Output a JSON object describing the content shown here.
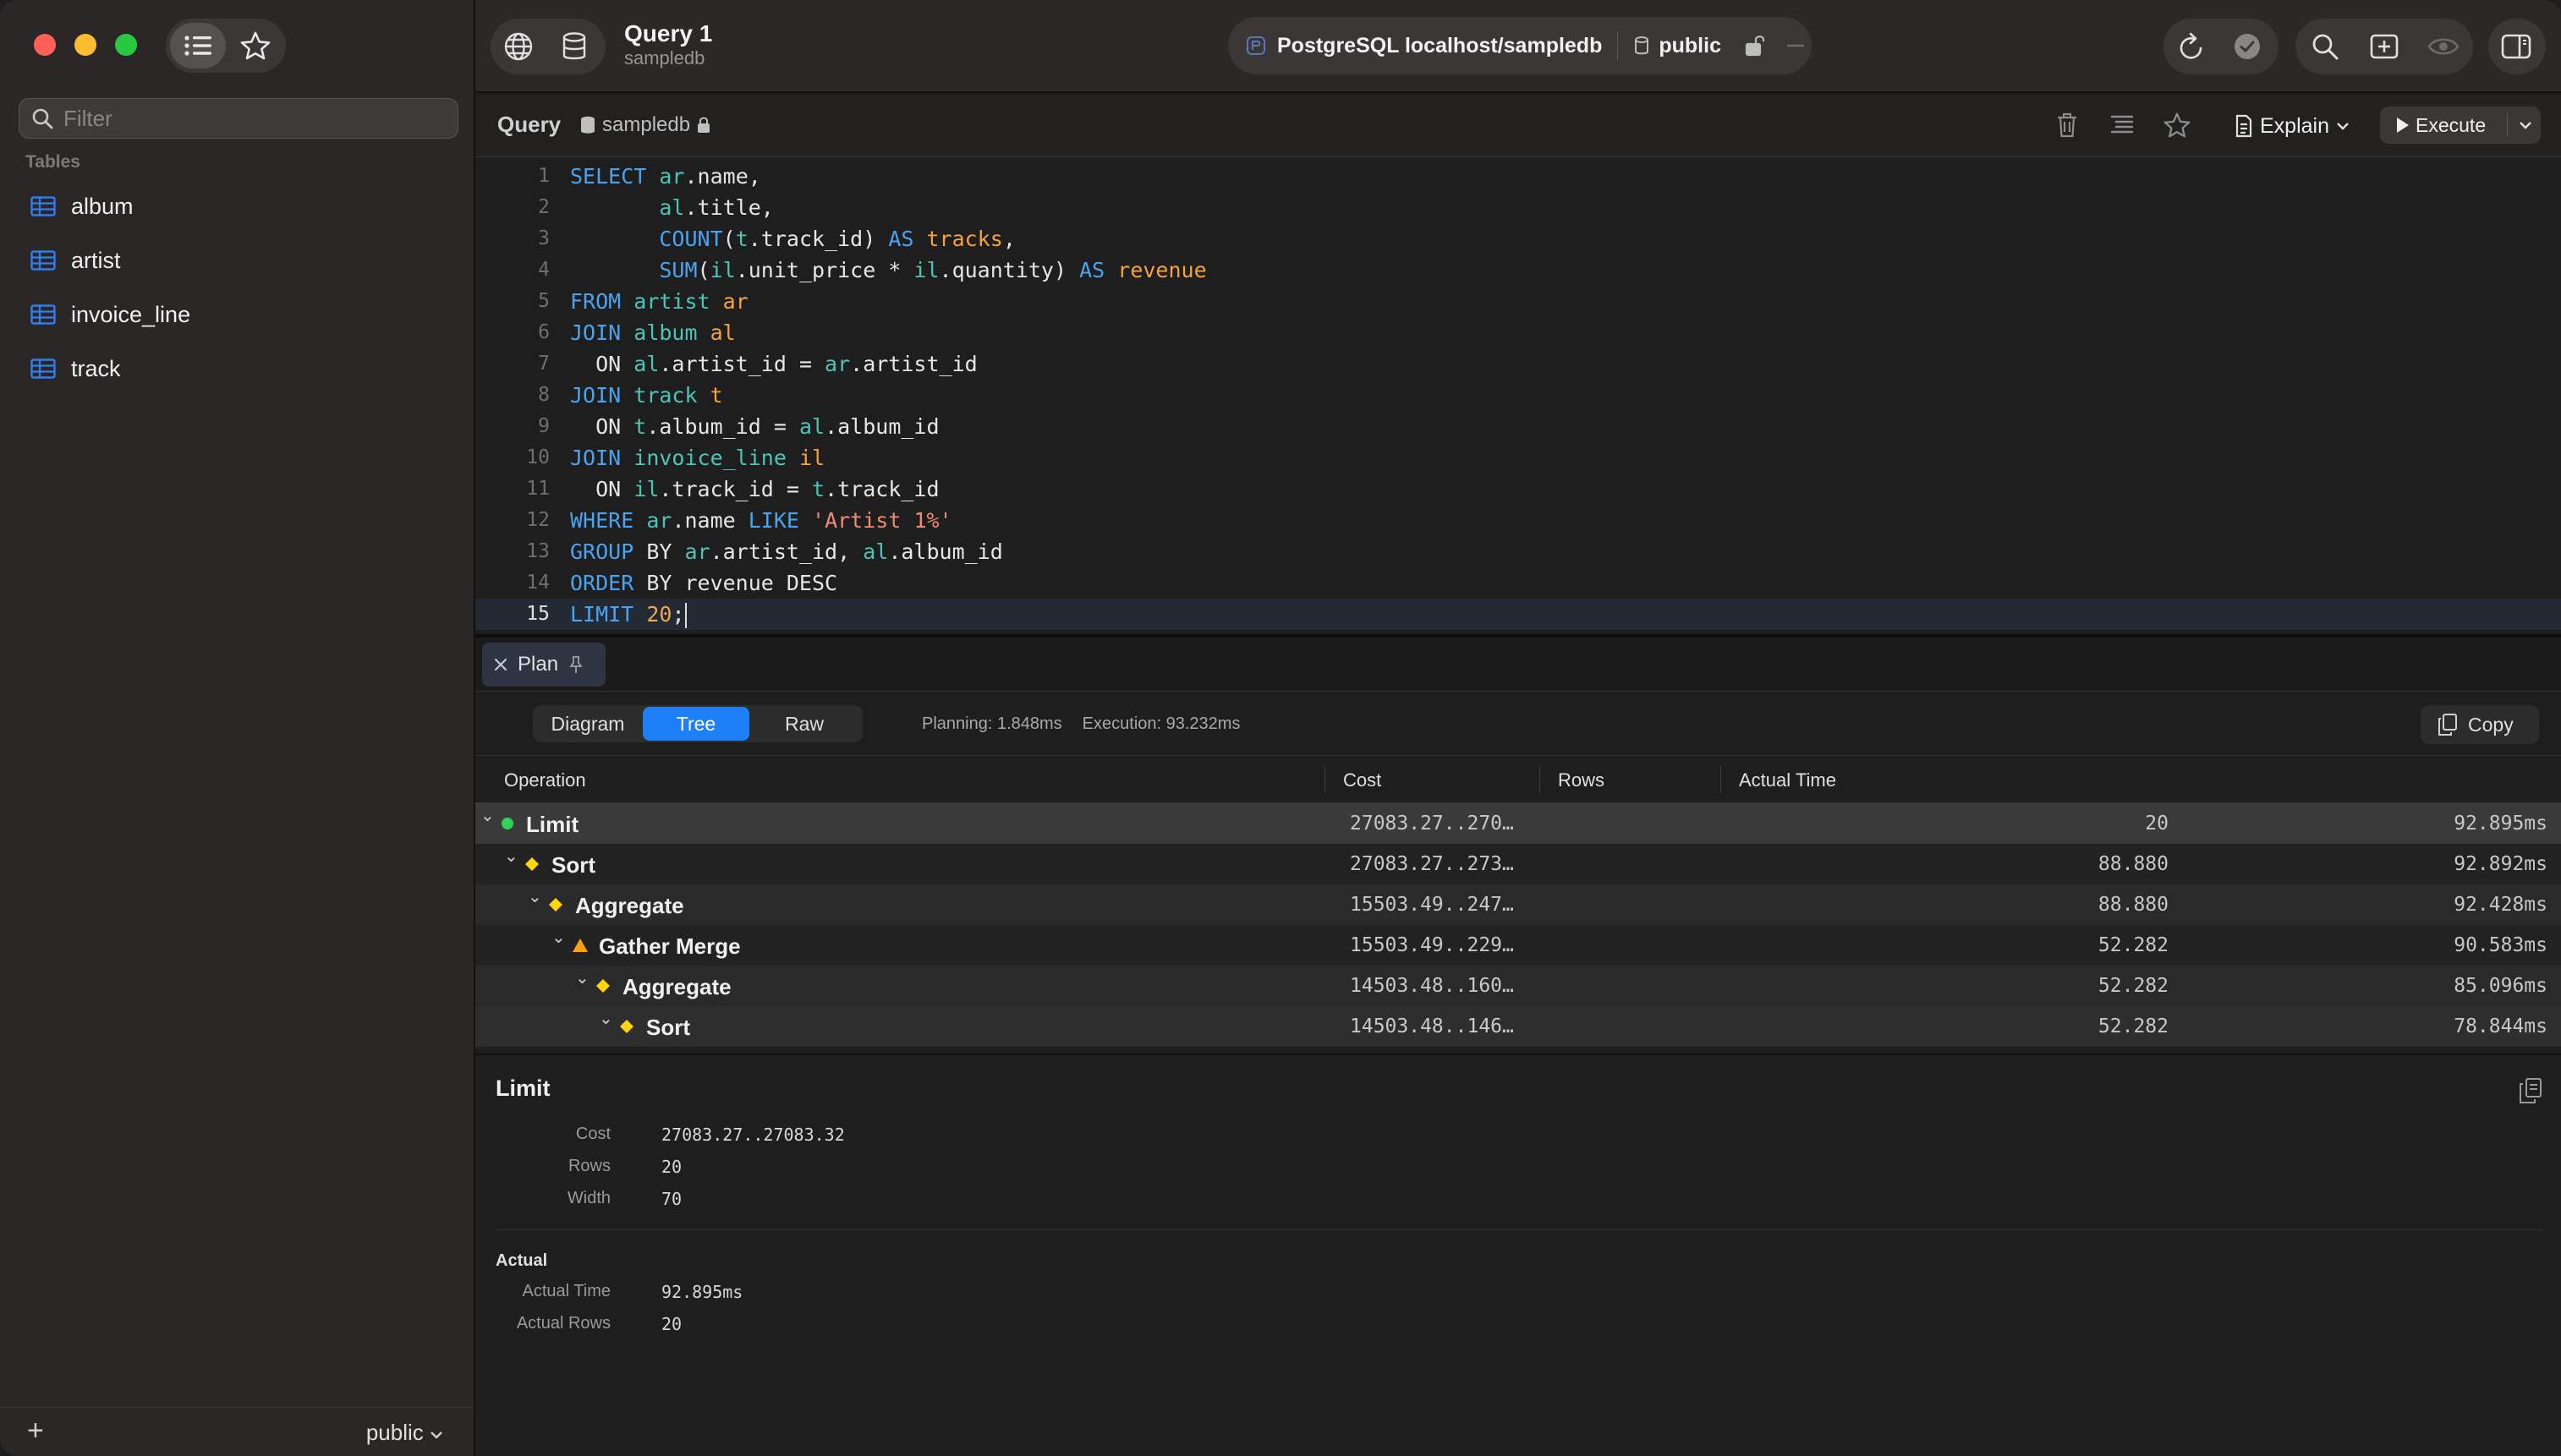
{
  "sidebar": {
    "filter_placeholder": "Filter",
    "section_label": "Tables",
    "tables": [
      "album",
      "artist",
      "invoice_line",
      "track"
    ],
    "footer_add": "+",
    "footer_schema": "public"
  },
  "toolbar": {
    "query_title": "Query 1",
    "query_subtitle": "sampledb",
    "connection": "PostgreSQL localhost/sampledb",
    "schema": "public"
  },
  "query_header": {
    "title": "Query",
    "database": "sampledb",
    "explain_label": "Explain",
    "execute_label": "Execute"
  },
  "editor": {
    "current_line": 15,
    "line_numbers": [
      "1",
      "2",
      "3",
      "4",
      "5",
      "6",
      "7",
      "8",
      "9",
      "10",
      "11",
      "12",
      "13",
      "14",
      "15"
    ],
    "lines": [
      "SELECT ar.name,",
      "       al.title,",
      "       COUNT(t.track_id) AS tracks,",
      "       SUM(il.unit_price * il.quantity) AS revenue",
      "FROM artist ar",
      "JOIN album al",
      "  ON al.artist_id = ar.artist_id",
      "JOIN track t",
      "  ON t.album_id = al.album_id",
      "JOIN invoice_line il",
      "  ON il.track_id = t.track_id",
      "WHERE ar.name LIKE 'Artist 1%'",
      "GROUP BY ar.artist_id, al.album_id",
      "ORDER BY revenue DESC",
      "LIMIT 20;"
    ]
  },
  "plan": {
    "tab_label": "Plan",
    "views": [
      "Diagram",
      "Tree",
      "Raw"
    ],
    "active_view": "Tree",
    "planning": "Planning: 1.848ms",
    "execution": "Execution: 93.232ms",
    "copy_label": "Copy",
    "columns": [
      "Operation",
      "Cost",
      "Rows",
      "Actual Time"
    ],
    "rows": [
      {
        "op": "Limit",
        "cost": "27083.27..270…",
        "rows": "20",
        "time": "92.895ms",
        "marker": "circle",
        "color": "#30d158"
      },
      {
        "op": "Sort",
        "cost": "27083.27..273…",
        "rows": "88.880",
        "time": "92.892ms",
        "marker": "diamond",
        "color": "#ffd60a"
      },
      {
        "op": "Aggregate",
        "cost": "15503.49..247…",
        "rows": "88.880",
        "time": "92.428ms",
        "marker": "diamond",
        "color": "#ffd60a"
      },
      {
        "op": "Gather Merge",
        "cost": "15503.49..229…",
        "rows": "52.282",
        "time": "90.583ms",
        "marker": "triangle",
        "color": "#ff9f0a"
      },
      {
        "op": "Aggregate",
        "cost": "14503.48..160…",
        "rows": "52.282",
        "time": "85.096ms",
        "marker": "diamond",
        "color": "#ffd60a"
      },
      {
        "op": "Sort",
        "cost": "14503.48..146…",
        "rows": "52.282",
        "time": "78.844ms",
        "marker": "diamond",
        "color": "#ffd60a"
      }
    ]
  },
  "detail": {
    "title": "Limit",
    "fields": [
      {
        "k": "Cost",
        "v": "27083.27..27083.32"
      },
      {
        "k": "Rows",
        "v": "20"
      },
      {
        "k": "Width",
        "v": "70"
      }
    ],
    "actual_title": "Actual",
    "actual_fields": [
      {
        "k": "Actual Time",
        "v": "92.895ms"
      },
      {
        "k": "Actual Rows",
        "v": "20"
      }
    ]
  },
  "colors": {
    "accent": "#1e80f6",
    "keyword": "#4aa3f0",
    "identifier": "#4ac6b7",
    "alias": "#f7a23b",
    "string": "#f08a75"
  }
}
